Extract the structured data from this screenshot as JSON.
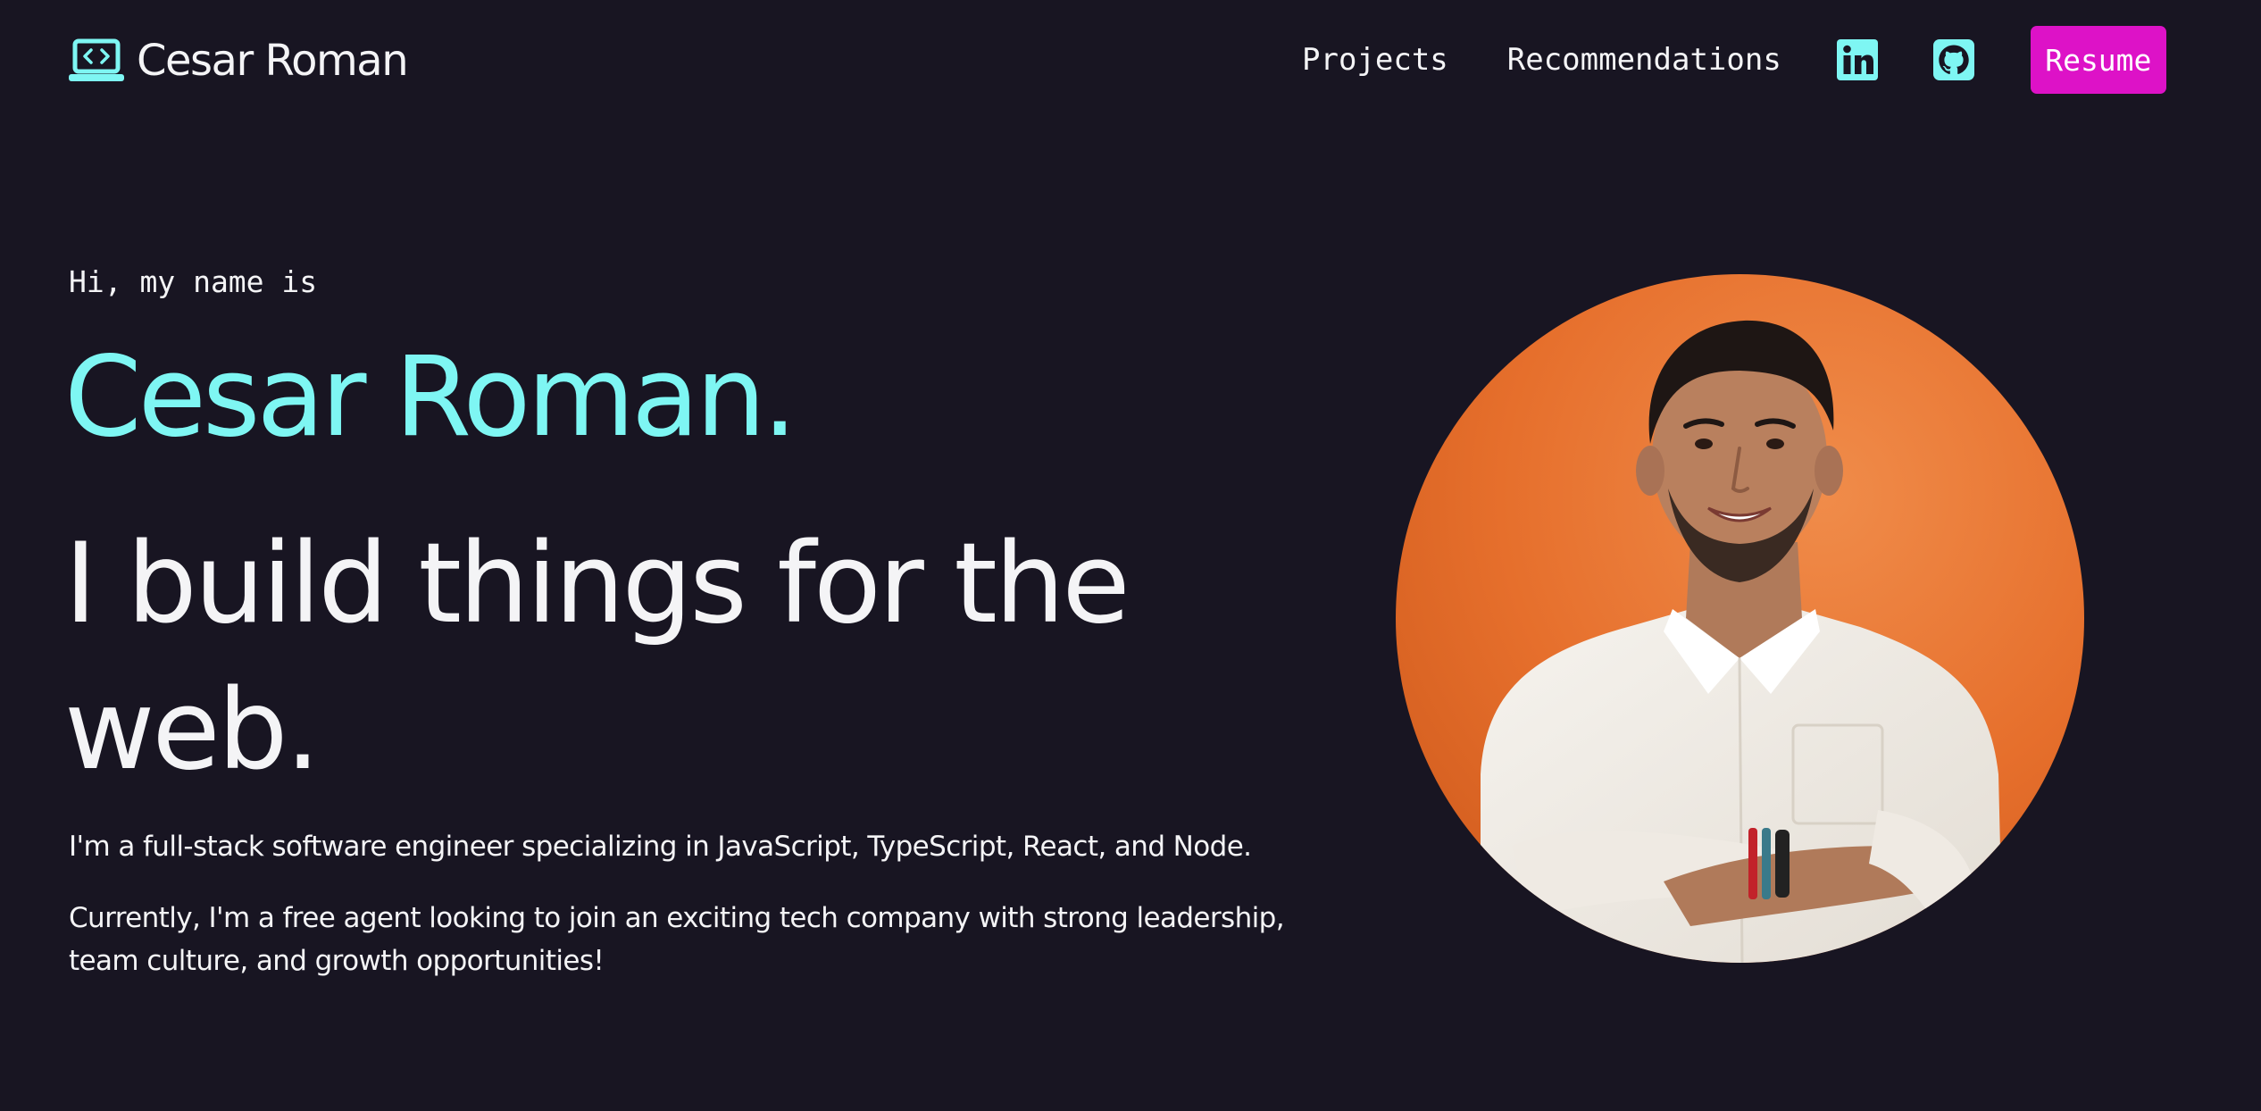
{
  "header": {
    "brand": {
      "icon": "laptop-code-icon",
      "name": "Cesar Roman"
    },
    "nav": {
      "projects_label": "Projects",
      "recommendations_label": "Recommendations",
      "linkedin_icon": "linkedin-icon",
      "github_icon": "github-icon",
      "resume_label": "Resume"
    }
  },
  "hero": {
    "intro": "Hi, my name is",
    "name": "Cesar Roman.",
    "tagline": "I build things for the web.",
    "bio_1": "I'm a full-stack software engineer specializing in JavaScript, TypeScript, React, and Node.",
    "bio_2": "Currently, I'm a free agent looking to join an exciting tech company with strong leadership, team culture, and growth opportunities!"
  },
  "portrait": {
    "subject": "profile-photo"
  },
  "colors": {
    "background": "#181522",
    "accent_cyan": "#7ef6f3",
    "accent_magenta": "#dd12c7",
    "text": "#f4f4f6",
    "photo_background": "#e66f2c"
  }
}
